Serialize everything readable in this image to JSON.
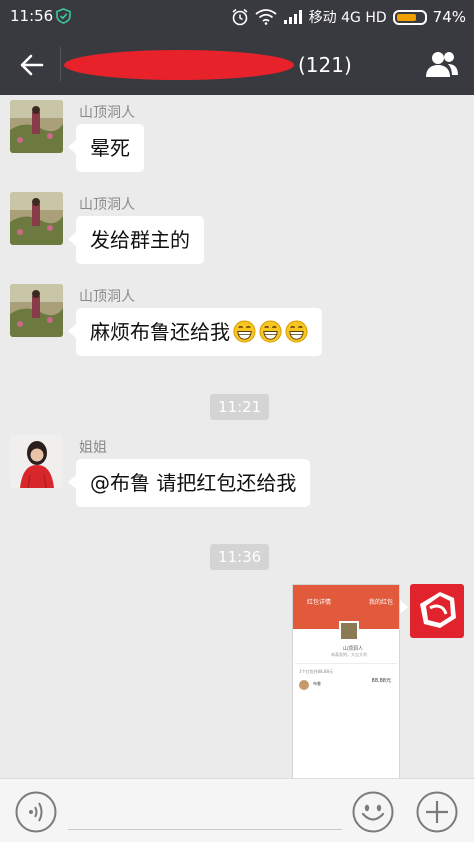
{
  "status_bar": {
    "time": "11:56",
    "carrier": "移动 4G HD",
    "battery": "74%",
    "battery_level": 0.74,
    "icons": [
      "shield-icon",
      "alarm-icon",
      "wifi-icon",
      "signal-icon",
      "battery-icon"
    ]
  },
  "header": {
    "member_count": "(121)",
    "back_icon": "back-arrow-icon",
    "members_icon": "group-members-icon",
    "bg_color": "#393a3f",
    "redaction_color": "#e8222a"
  },
  "messages": [
    {
      "sender": "山顶洞人",
      "text": "晕死",
      "emoji_count": 0
    },
    {
      "sender": "山顶洞人",
      "text": "发给群主的",
      "emoji_count": 0
    },
    {
      "sender": "山顶洞人",
      "text": "麻烦布鲁还给我",
      "emoji_count": 3
    },
    {
      "sender": "姐姐",
      "text": "@布鲁 请把红包还给我",
      "emoji_count": 0
    }
  ],
  "timestamps": [
    "11:21",
    "11:36"
  ],
  "sent_image": {
    "header_title": "红包详情",
    "header_right": "我的红包",
    "name": "山顶洞人",
    "subtitle": "恭喜发财，大吉大利",
    "list_caption": "1个红包共88.88元",
    "list_name": "布鲁",
    "amount": "88.88元",
    "accent": "#e25a3c"
  },
  "input_bar": {
    "voice_icon": "voice-icon",
    "emoji_icon": "emoji-smiley-icon",
    "more_icon": "plus-icon"
  }
}
